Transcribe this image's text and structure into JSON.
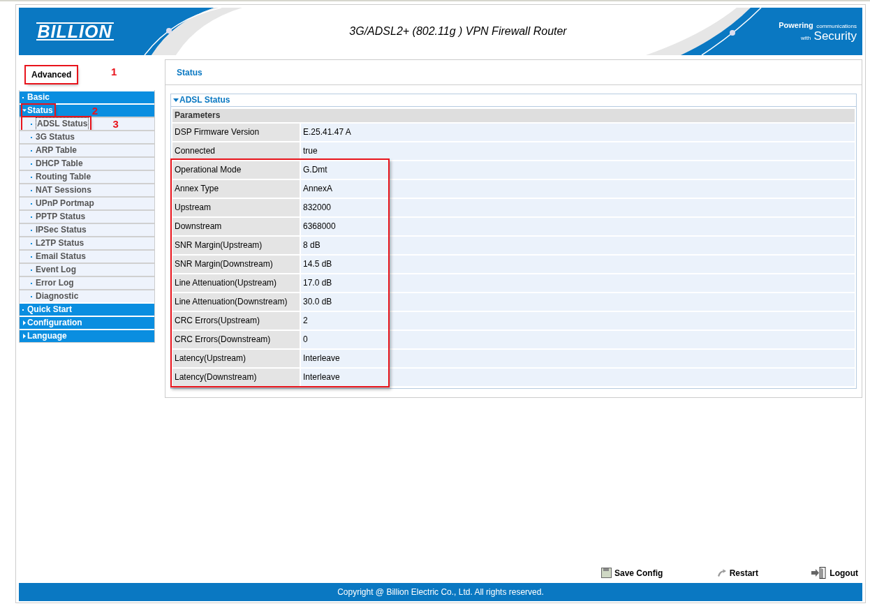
{
  "header": {
    "logo": "BILLION",
    "title": "3G/ADSL2+ (802.11g ) VPN Firewall Router",
    "tagline_1": "Powering",
    "tagline_2": "communications",
    "tagline_3": "with",
    "tagline_4": "Security"
  },
  "sidebar": {
    "mode": {
      "label": "Advanced",
      "annotation": "1"
    },
    "menu": [
      {
        "label": "Basic",
        "kind": "link"
      },
      {
        "label": "Status",
        "kind": "folder",
        "expanded": true,
        "annotation": "2",
        "children": [
          {
            "label": "ADSL Status",
            "selected": true,
            "annotation": "3"
          },
          {
            "label": "3G Status",
            "selected": false
          },
          {
            "label": "ARP Table",
            "selected": false
          },
          {
            "label": "DHCP Table",
            "selected": false
          },
          {
            "label": "Routing Table",
            "selected": false
          },
          {
            "label": "NAT Sessions",
            "selected": false
          },
          {
            "label": "UPnP Portmap",
            "selected": false
          },
          {
            "label": "PPTP Status",
            "selected": false
          },
          {
            "label": "IPSec Status",
            "selected": false
          },
          {
            "label": "L2TP Status",
            "selected": false
          },
          {
            "label": "Email Status",
            "selected": false
          },
          {
            "label": "Event Log",
            "selected": false
          },
          {
            "label": "Error Log",
            "selected": false
          },
          {
            "label": "Diagnostic",
            "selected": false
          }
        ]
      },
      {
        "label": "Quick Start",
        "kind": "link"
      },
      {
        "label": "Configuration",
        "kind": "folder",
        "expanded": false
      },
      {
        "label": "Language",
        "kind": "folder",
        "expanded": false
      }
    ]
  },
  "content": {
    "title": "Status",
    "section": {
      "title": "ADSL Status",
      "expanded": true,
      "header": "Parameters",
      "rows": [
        {
          "label": "DSP Firmware Version",
          "value": "E.25.41.47 A",
          "annotated": false
        },
        {
          "label": "Connected",
          "value": "true",
          "annotated": false
        },
        {
          "label": "Operational Mode",
          "value": "G.Dmt",
          "annotated": true
        },
        {
          "label": "Annex Type",
          "value": "AnnexA",
          "annotated": true
        },
        {
          "label": "Upstream",
          "value": "832000",
          "annotated": true
        },
        {
          "label": "Downstream",
          "value": "6368000",
          "annotated": true
        },
        {
          "label": "SNR Margin(Upstream)",
          "value": "8 dB",
          "annotated": true
        },
        {
          "label": "SNR Margin(Downstream)",
          "value": "14.5 dB",
          "annotated": true
        },
        {
          "label": "Line Attenuation(Upstream)",
          "value": "17.0 dB",
          "annotated": true
        },
        {
          "label": "Line Attenuation(Downstream)",
          "value": "30.0 dB",
          "annotated": true
        },
        {
          "label": "CRC Errors(Upstream)",
          "value": "2",
          "annotated": true
        },
        {
          "label": "CRC Errors(Downstream)",
          "value": "0",
          "annotated": true
        },
        {
          "label": "Latency(Upstream)",
          "value": "Interleave",
          "annotated": true
        },
        {
          "label": "Latency(Downstream)",
          "value": "Interleave",
          "annotated": true
        }
      ]
    }
  },
  "footer": {
    "actions": [
      {
        "label": "Save Config",
        "kind": "save"
      },
      {
        "label": "Restart",
        "kind": "restart"
      },
      {
        "label": "Logout",
        "kind": "logout"
      }
    ],
    "copyright": "Copyright @ Billion Electric Co., Ltd. All rights reserved."
  }
}
